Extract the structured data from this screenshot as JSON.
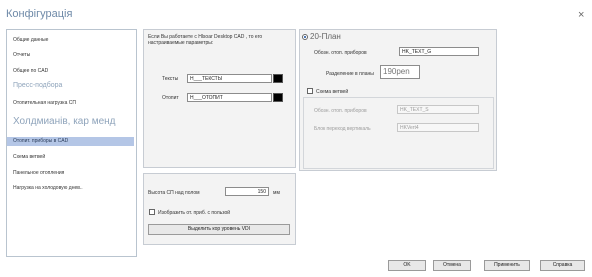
{
  "window": {
    "title": "Конфігурація",
    "close_glyph": "×"
  },
  "sidebar": {
    "items": [
      {
        "label": "Общие данные"
      },
      {
        "label": "Отчеты"
      },
      {
        "label": "Общее по CAD"
      },
      {
        "label": "Пресс-подбора"
      },
      {
        "label": "Отопительная нагрузка СП"
      },
      {
        "label": "Холдмианів, кар менд"
      },
      {
        "label": "Отопит. приборы в CAD"
      },
      {
        "label": "Схема ветвей"
      },
      {
        "label": "Панельное отопления"
      },
      {
        "label": "Нагрузка на холодовую днев.."
      }
    ]
  },
  "left_panel": {
    "intro": "Если Вы работаете с Нlsoar Desktop CAD , то его настраиваемые параметры:",
    "text_label": "Тексты",
    "text_value": "H___ТЕКСТЫ",
    "lines_label": "Отопит",
    "lines_value": "H___ОТОПИТ"
  },
  "bottom_panel": {
    "height_label": "Высота СП над полом",
    "height_value": "150",
    "height_unit": "мм",
    "checkbox_label": "Изобразить от. приб. с пользой",
    "button_label": "Выделить кор уровень VDI"
  },
  "right_panel": {
    "plan_label": "20-План",
    "legend_label": "Обозн. отоп. приборов",
    "legend_value": "HK_TEXT_G",
    "section_label": "Разделение в планы",
    "section_value": "190pen",
    "branch_label": "Схема ветвей",
    "branch_legend_label": "Обозн. отоп. приборов",
    "branch_legend_value": "HK_TEXT_S",
    "branch_block_label": "Блок переход вертикаль",
    "branch_block_value": "HKVert4"
  },
  "footer": {
    "ok": "OK",
    "cancel": "Отмена",
    "apply": "Применить",
    "help": "Справка"
  }
}
